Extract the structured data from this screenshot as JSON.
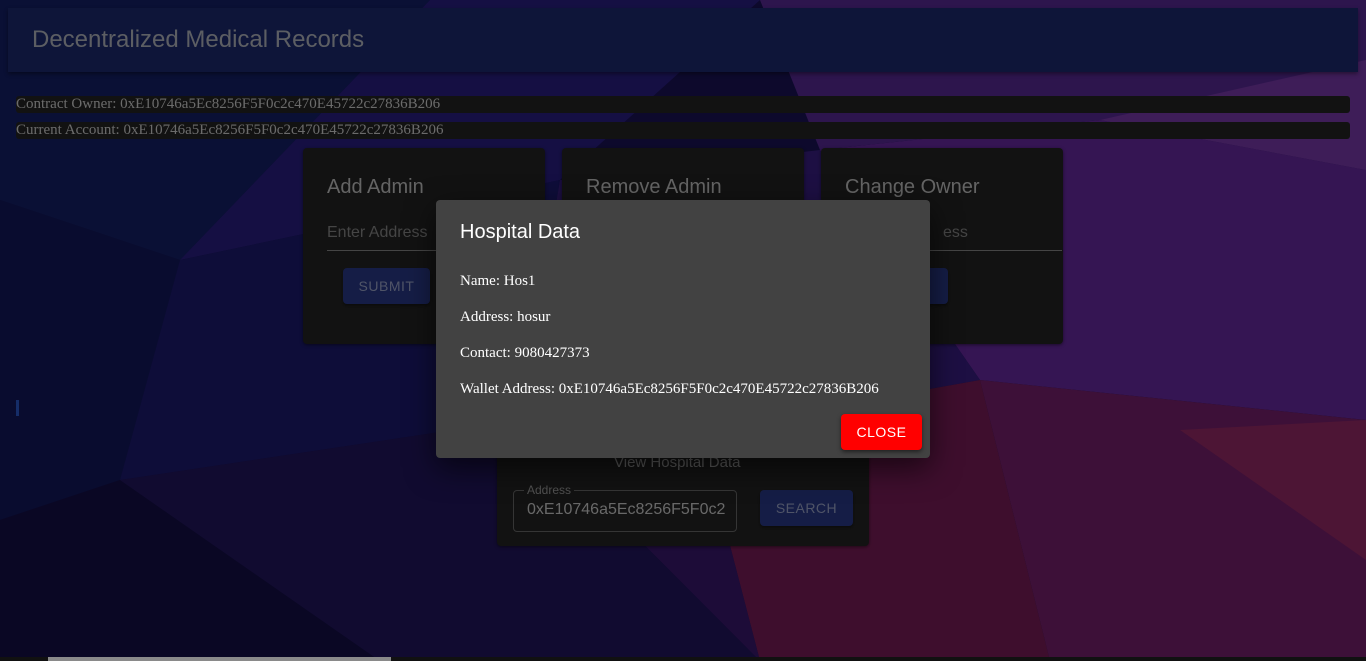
{
  "app": {
    "title": "Decentralized Medical Records"
  },
  "info": {
    "contract_owner": "Contract Owner: 0xE10746a5Ec8256F5F0c2c470E45722c27836B206",
    "current_account": "Current Account: 0xE10746a5Ec8256F5F0c2c470E45722c27836B206"
  },
  "cards": {
    "add_admin": {
      "title": "Add Admin",
      "placeholder": "Enter Address",
      "button": "SUBMIT"
    },
    "remove_admin": {
      "title": "Remove Admin"
    },
    "change_owner": {
      "title": "Change Owner",
      "placeholder_tail": "ess"
    }
  },
  "view_hospital": {
    "title": "View Hospital Data",
    "field_label": "Address",
    "field_value": "0xE10746a5Ec8256F5F0c2",
    "button": "SEARCH"
  },
  "dialog": {
    "title": "Hospital Data",
    "name": "Name: Hos1",
    "address": "Address: hosur",
    "contact": "Contact: 9080427373",
    "wallet": "Wallet Address: 0xE10746a5Ec8256F5F0c2c470E45722c27836B206",
    "close": "CLOSE"
  },
  "colors": {
    "appbar": "#1d2a72",
    "button_primary": "#2a3a8c",
    "close_button": "#ff0000",
    "dialog_bg": "#424242"
  }
}
